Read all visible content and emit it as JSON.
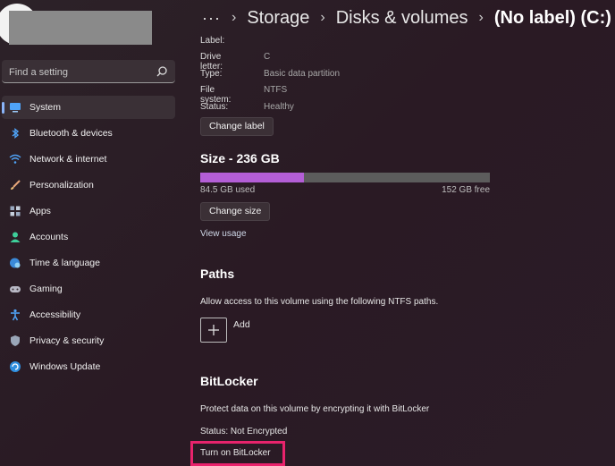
{
  "sidebar": {
    "search_placeholder": "Find a setting",
    "items": [
      {
        "label": "System",
        "icon": "monitor-icon",
        "active": true
      },
      {
        "label": "Bluetooth & devices",
        "icon": "bluetooth-icon"
      },
      {
        "label": "Network & internet",
        "icon": "wifi-icon"
      },
      {
        "label": "Personalization",
        "icon": "brush-icon"
      },
      {
        "label": "Apps",
        "icon": "apps-icon"
      },
      {
        "label": "Accounts",
        "icon": "person-icon"
      },
      {
        "label": "Time & language",
        "icon": "globe-clock-icon"
      },
      {
        "label": "Gaming",
        "icon": "controller-icon"
      },
      {
        "label": "Accessibility",
        "icon": "accessibility-icon"
      },
      {
        "label": "Privacy & security",
        "icon": "shield-icon"
      },
      {
        "label": "Windows Update",
        "icon": "update-icon"
      }
    ]
  },
  "breadcrumb": {
    "more": "···",
    "items": [
      "Storage",
      "Disks & volumes",
      "(No label) (C:)"
    ]
  },
  "properties": [
    {
      "key": "Label:",
      "value": ""
    },
    {
      "key": "Drive letter:",
      "value": "C"
    },
    {
      "key": "Type:",
      "value": "Basic data partition"
    },
    {
      "key": "File system:",
      "value": "NTFS"
    },
    {
      "key": "Status:",
      "value": "Healthy"
    }
  ],
  "buttons": {
    "change_label": "Change label",
    "change_size": "Change size"
  },
  "size": {
    "title": "Size - 236 GB",
    "used": "84.5 GB used",
    "free": "152 GB free",
    "used_fraction": 0.358,
    "view_usage": "View usage"
  },
  "paths": {
    "title": "Paths",
    "description": "Allow access to this volume using the following NTFS paths.",
    "add_label": "Add"
  },
  "bitlocker": {
    "title": "BitLocker",
    "description": "Protect data on this volume by encrypting it with BitLocker",
    "status": "Status: Not Encrypted",
    "turn_on": "Turn on BitLocker"
  },
  "colors": {
    "accent": "#8ab4f8",
    "bar_fill": "#b35ed6",
    "highlight": "#e8236c"
  }
}
